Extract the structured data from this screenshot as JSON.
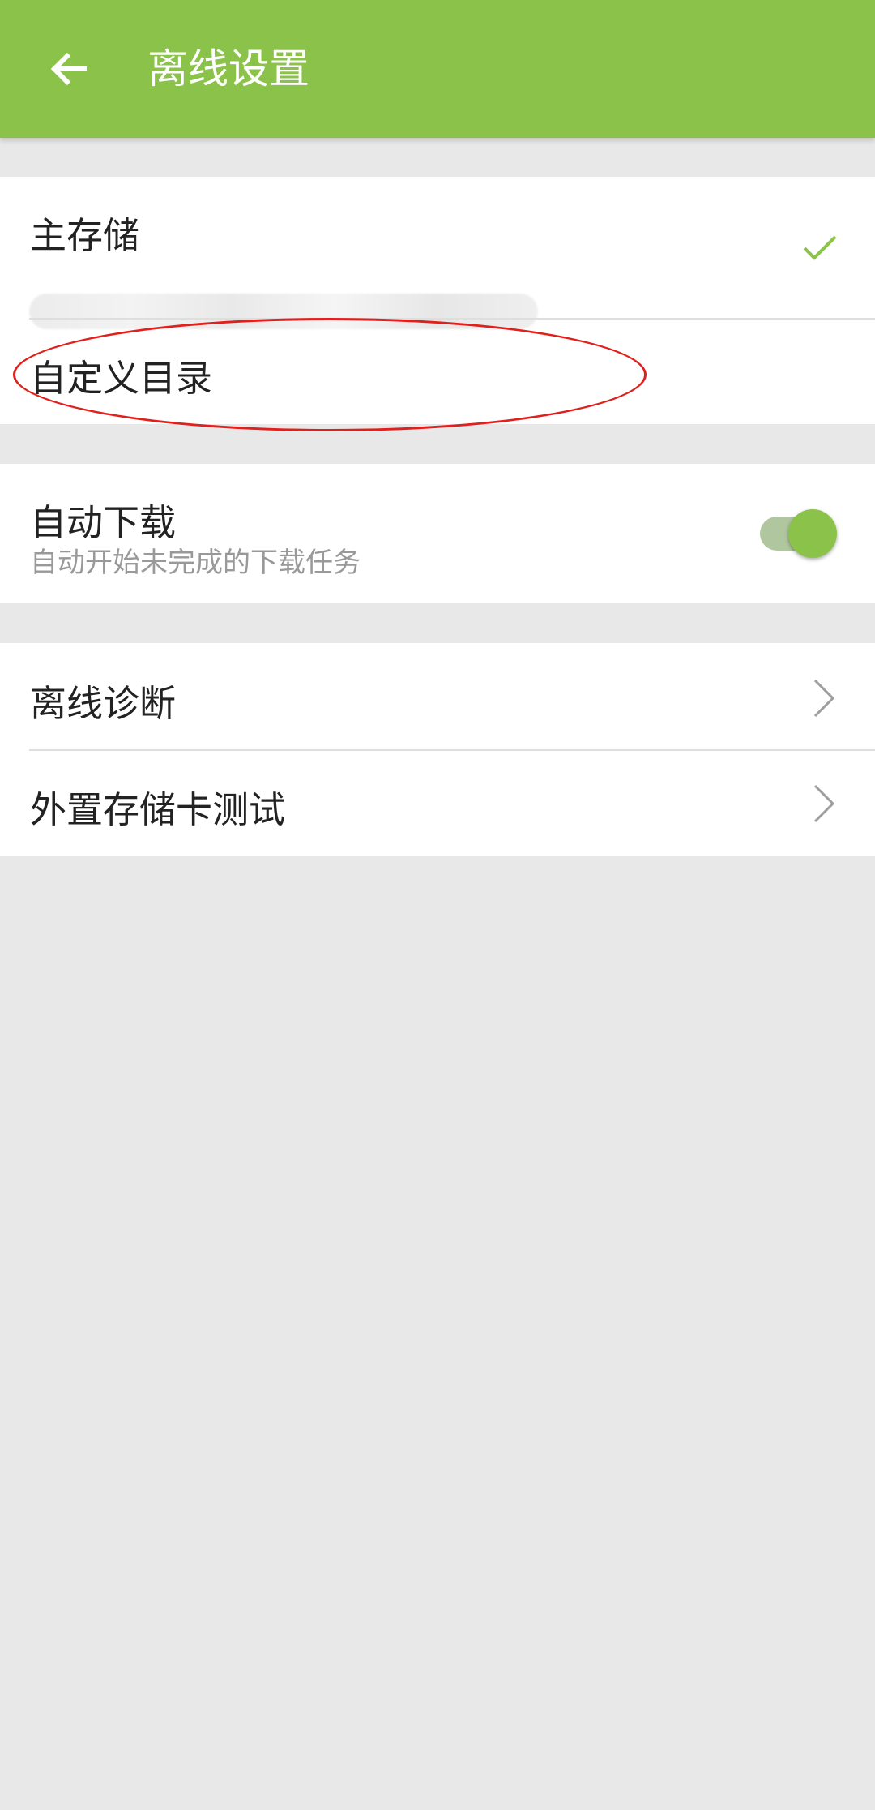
{
  "colors": {
    "accent": "#8bc34a",
    "toggle_track": "#8fae76",
    "annotation": "#e0201c",
    "background": "#e8e8e8"
  },
  "appbar": {
    "back_icon": "arrow-left-icon",
    "title": "离线设置"
  },
  "storage": {
    "main_storage": {
      "title": "主存储",
      "selected": true,
      "icon": "checkmark-icon"
    },
    "custom_directory": {
      "title": "自定义目录"
    }
  },
  "auto_download": {
    "title": "自动下载",
    "subtitle": "自动开始未完成的下载任务",
    "enabled": true
  },
  "tools": {
    "offline_diagnosis": {
      "title": "离线诊断",
      "icon": "chevron-right-icon"
    },
    "sd_card_test": {
      "title": "外置存储卡测试",
      "icon": "chevron-right-icon"
    }
  }
}
